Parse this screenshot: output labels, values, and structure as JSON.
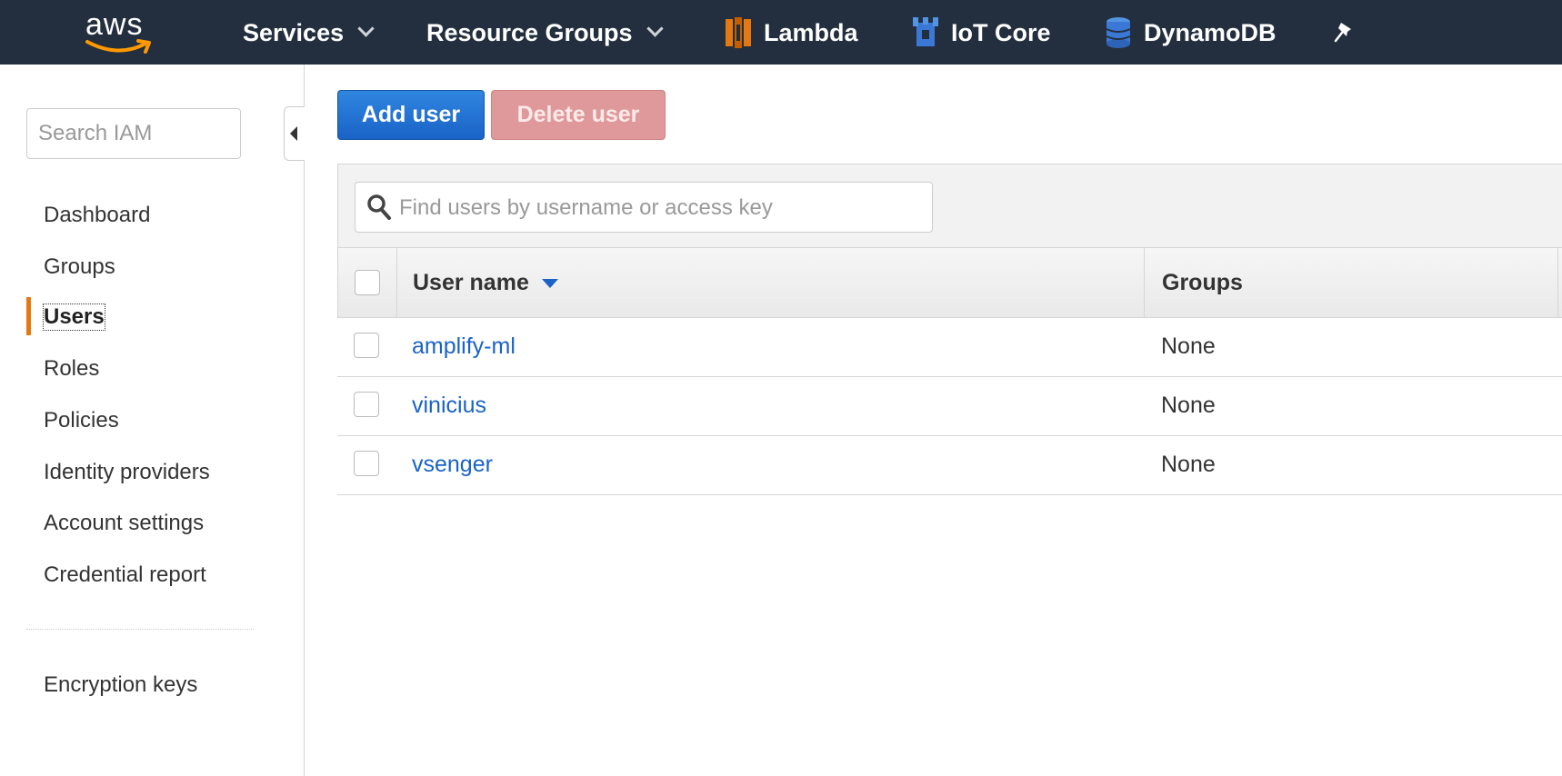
{
  "topnav": {
    "logo_text": "aws",
    "services_label": "Services",
    "resource_groups_label": "Resource Groups",
    "shortcuts": [
      {
        "label": "Lambda",
        "icon": "lambda-icon",
        "color": "#e47911"
      },
      {
        "label": "IoT Core",
        "icon": "iot-core-icon",
        "color": "#3b78d6"
      },
      {
        "label": "DynamoDB",
        "icon": "dynamodb-icon",
        "color": "#3b78d6"
      }
    ],
    "pin_icon": "pin-icon",
    "background": "#232f3e"
  },
  "sidebar": {
    "search_placeholder": "Search IAM",
    "items": [
      {
        "label": "Dashboard"
      },
      {
        "label": "Groups"
      },
      {
        "label": "Users",
        "active": true
      },
      {
        "label": "Roles"
      },
      {
        "label": "Policies"
      },
      {
        "label": "Identity providers"
      },
      {
        "label": "Account settings"
      },
      {
        "label": "Credential report"
      }
    ],
    "secondary_items": [
      {
        "label": "Encryption keys"
      }
    ],
    "active_accent": "#e47911"
  },
  "actions": {
    "add_user_label": "Add user",
    "delete_user_label": "Delete user"
  },
  "users_table": {
    "search_placeholder": "Find users by username or access key",
    "columns": [
      "User name",
      "Groups"
    ],
    "rows": [
      {
        "user_name": "amplify-ml",
        "groups": "None"
      },
      {
        "user_name": "vinicius",
        "groups": "None"
      },
      {
        "user_name": "vsenger",
        "groups": "None"
      }
    ],
    "link_color": "#1a63c7"
  }
}
